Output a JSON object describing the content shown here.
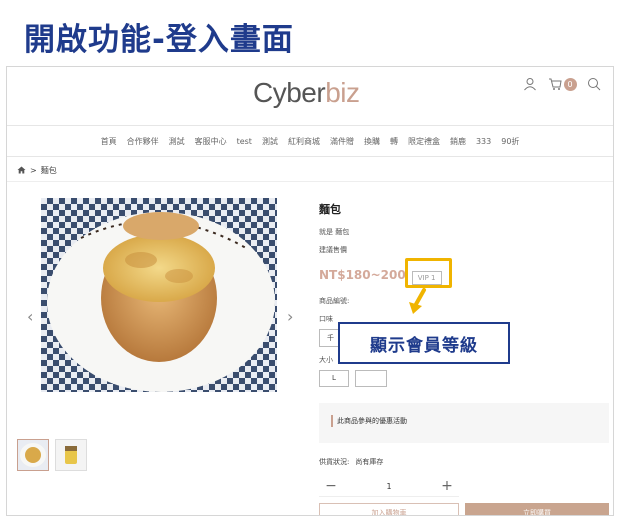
{
  "slide": {
    "title": "開啟功能-登入畫面"
  },
  "header": {
    "logo_main": "Cyber",
    "logo_accent": "biz",
    "cart_count": "0",
    "icons": [
      "user-icon",
      "cart-icon",
      "search-icon"
    ],
    "accent_color": "#c9a08f"
  },
  "nav": {
    "items": [
      "首頁",
      "合作夥伴",
      "測試",
      "客服中心",
      "test",
      "測試",
      "紅利商城",
      "滿件贈",
      "換購",
      "轉",
      "限定禮盒",
      "銷鹿",
      "333",
      "90折"
    ]
  },
  "breadcrumb": {
    "home_icon": "home-icon",
    "separator": ">",
    "current": "麵包"
  },
  "product": {
    "name": "麵包",
    "subtitle": "就是 麵包",
    "price_label": "建議售價",
    "price": "NT$180~200",
    "vip_level": "VIP 1",
    "sku_label": "商品編號:",
    "flavor_label": "口味",
    "flavor_options": [
      "千",
      ""
    ],
    "size_label": "大小",
    "size_options": [
      "L",
      ""
    ],
    "promo_text": "此商品參與的優惠活動",
    "stock_label": "供貨狀況:",
    "stock_value": "尚有庫存",
    "quantity": "1",
    "add_to_cart": "加入購物車",
    "buy_now": "立即購買"
  },
  "annotation": {
    "callout": "顯示會員等級",
    "highlight_color": "#f0b400"
  }
}
